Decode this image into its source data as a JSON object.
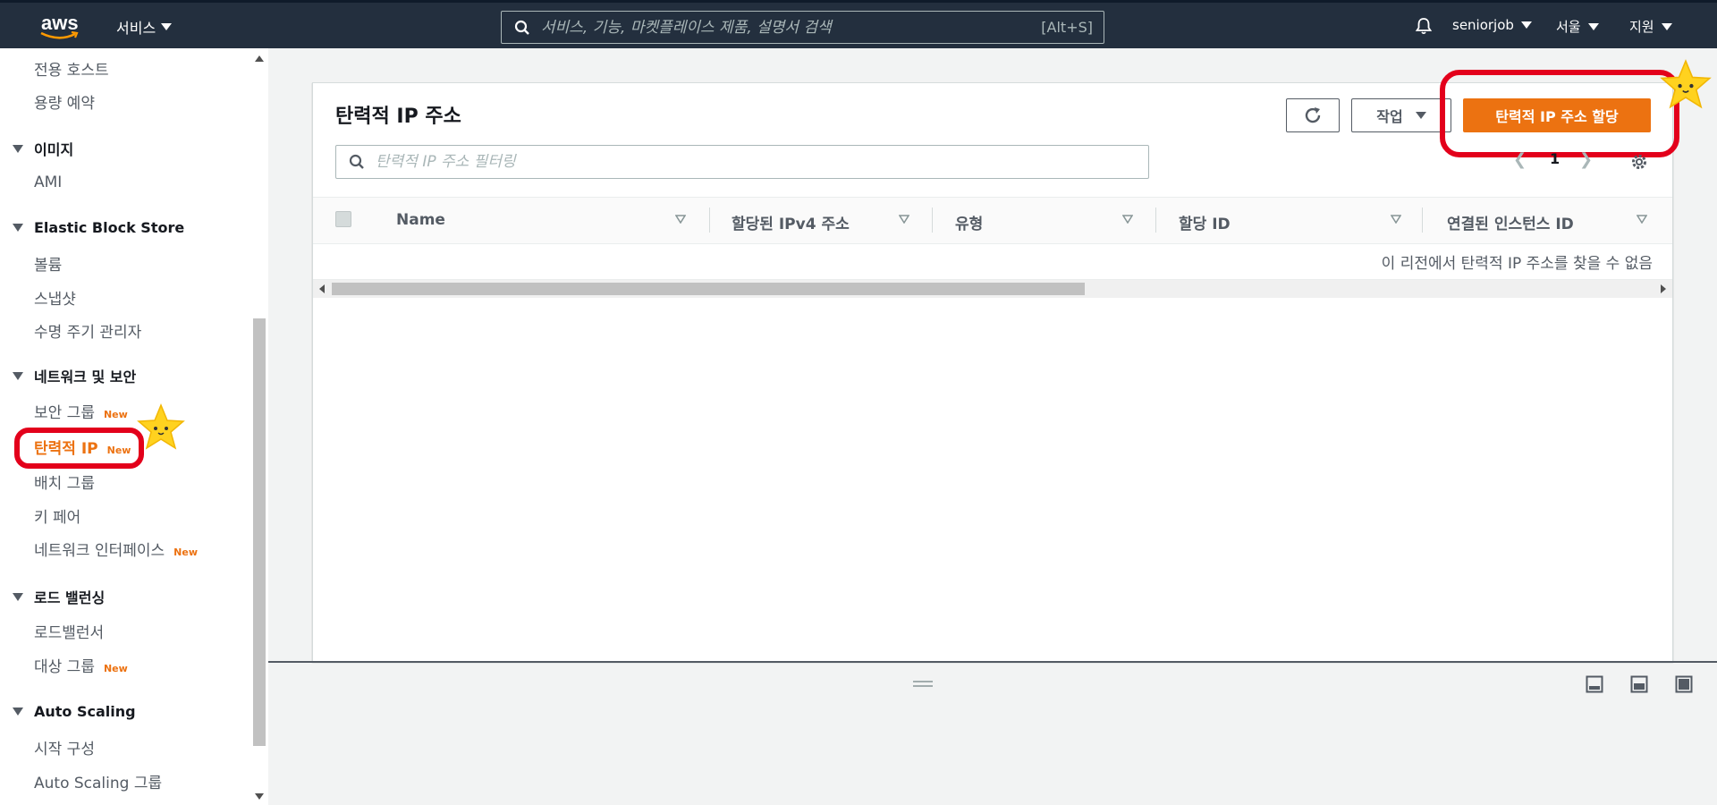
{
  "topnav": {
    "logo_text": "aws",
    "services_label": "서비스",
    "search_placeholder": "서비스, 기능, 마켓플레이스 제품, 설명서 검색",
    "search_shortcut": "[Alt+S]",
    "account_label": "seniorjob",
    "region_label": "서울",
    "support_label": "지원"
  },
  "sidebar": {
    "items": [
      {
        "type": "link",
        "label": "전용 호스트"
      },
      {
        "type": "link",
        "label": "용량 예약"
      },
      {
        "type": "section",
        "label": "이미지"
      },
      {
        "type": "link",
        "label": "AMI"
      },
      {
        "type": "section",
        "label": "Elastic Block Store"
      },
      {
        "type": "link",
        "label": "볼륨"
      },
      {
        "type": "link",
        "label": "스냅샷"
      },
      {
        "type": "link",
        "label": "수명 주기 관리자"
      },
      {
        "type": "section",
        "label": "네트워크 및 보안"
      },
      {
        "type": "link",
        "label": "보안 그룹",
        "badge": "New"
      },
      {
        "type": "link",
        "label": "탄력적 IP",
        "badge": "New",
        "active": true
      },
      {
        "type": "link",
        "label": "배치 그룹"
      },
      {
        "type": "link",
        "label": "키 페어"
      },
      {
        "type": "link",
        "label": "네트워크 인터페이스",
        "badge": "New"
      },
      {
        "type": "section",
        "label": "로드 밸런싱"
      },
      {
        "type": "link",
        "label": "로드밸런서"
      },
      {
        "type": "link",
        "label": "대상 그룹",
        "badge": "New"
      },
      {
        "type": "section",
        "label": "Auto Scaling"
      },
      {
        "type": "link",
        "label": "시작 구성"
      },
      {
        "type": "link",
        "label": "Auto Scaling 그룹"
      }
    ]
  },
  "main": {
    "title": "탄력적 IP 주소",
    "filter_placeholder": "탄력적 IP 주소 필터링",
    "actions_label": "작업",
    "allocate_label": "탄력적 IP 주소 할당",
    "page_number": "1",
    "columns": [
      "Name",
      "할당된 IPv4 주소",
      "유형",
      "할당 ID",
      "연결된 인스턴스 ID"
    ],
    "empty_message": "이 리전에서 탄력적 IP 주소를 찾을 수 없음"
  },
  "colors": {
    "nav_bg": "#232f3e",
    "accent": "#ec7211",
    "annotation_ring": "#e3001b",
    "star": "#ffd21f"
  }
}
